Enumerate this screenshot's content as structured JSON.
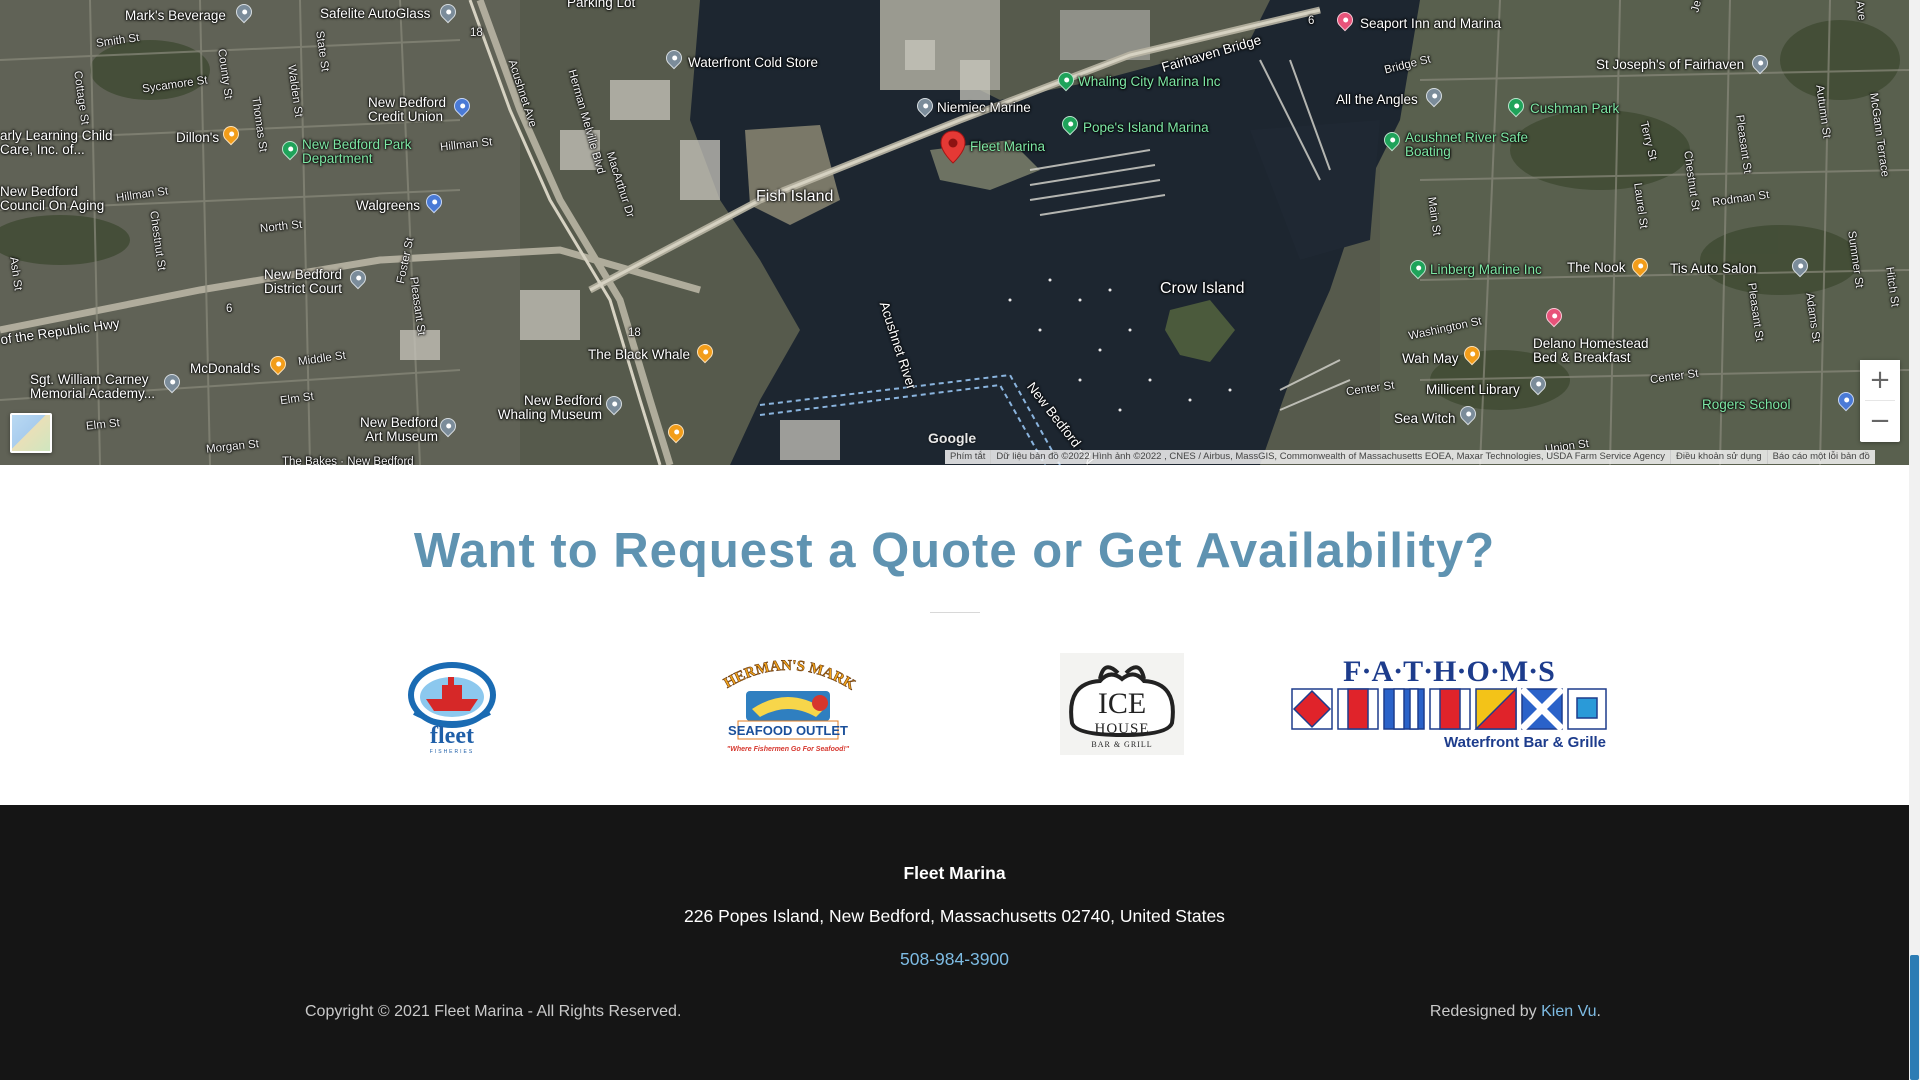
{
  "map": {
    "labels": {
      "marks_beverage": "Mark's Beverage",
      "safelite": "Safelite AutoGlass",
      "parking_lot": "Parking Lot",
      "waterfront_cold_store": "Waterfront Cold Store",
      "seaport_inn": "Seaport Inn and Marina",
      "fairhaven_bridge": "Fairhaven Bridge",
      "whaling_city_marina": "Whaling City Marina Inc",
      "niemiec_marine": "Niemiec Marine",
      "popes_island_marina": "Pope's Island Marina",
      "fleet_marina": "Fleet Marina",
      "fish_island": "Fish Island",
      "all_the_angles": "All the Angles",
      "acushnet_safe_boating": "Acushnet River Safe Boating",
      "st_josephs": "St Joseph's of Fairhaven",
      "cushman_park": "Cushman Park",
      "nb_credit_union": "New Bedford Credit Union",
      "dillons": "Dillon's",
      "nb_park_dept": "New Bedford Park Department",
      "early_learning": "arly Learning Child Care, Inc. of...",
      "nb_council_aging": "New Bedford Council On Aging",
      "walgreens": "Walgreens",
      "nb_district_court": "New Bedford District Court",
      "republic_hwy": "of the Republic Hwy",
      "mcdonalds": "McDonald's",
      "carney_academy": "Sgt. William Carney Memorial Academy...",
      "black_whale": "The Black Whale",
      "nb_whaling_museum": "New Bedford Whaling Museum",
      "nb_art_museum": "New Bedford Art Museum",
      "acushnet_river": "Acushnet River",
      "crow_island": "Crow Island",
      "linberg_marine": "Linberg Marine Inc",
      "the_nook": "The Nook",
      "tis_auto_salon": "Tis Auto Salon",
      "delano_homestead": "Delano Homestead Bed & Breakfast",
      "wah_may": "Wah May",
      "millicent_library": "Millicent Library",
      "sea_witch": "Sea Witch",
      "rogers_school": "Rogers School",
      "new_bedford_route": "New Bedford - N",
      "the_bakes": "The Bakes · New Bedford"
    },
    "streets": {
      "smith_st": "Smith St",
      "sycamore_st": "Sycamore St",
      "cottage_st": "Cottage St",
      "county_st": "County St",
      "thomas_st": "Thomas St",
      "walden_st": "Walden St",
      "state_st": "State St",
      "hillman_st": "Hillman St",
      "hillman_st2": "Hillman St",
      "north_st": "North St",
      "chestnut_st": "Chestnut St",
      "ash_st": "Ash St",
      "foster_st": "Foster St",
      "pleasant_st": "Pleasant St",
      "middle_st": "Middle St",
      "elm_st": "Elm St",
      "elm_st2": "Elm St",
      "morgan_st": "Morgan St",
      "acushnet_ave": "Acushnet Ave",
      "herman_melville": "Herman Melville Blvd",
      "macarthur_dr": "MacArthur Dr",
      "bridge_st": "Bridge St",
      "main_st": "Main St",
      "terry_st": "Terry St",
      "laurel_st": "Laurel St",
      "chestnut_st2": "Chestnut St",
      "rodman_st": "Rodman St",
      "pleasant_st2": "Pleasant St",
      "adams_st": "Adams St",
      "summer_st": "Summer St",
      "hitch_st": "Hitch St",
      "autumn_st": "Autumn St",
      "jefferson_st": "Jefferson St",
      "mcgann_terrace": "McGann Terrace",
      "washington_st": "Washington St",
      "center_st": "Center St",
      "center_st2": "Center St",
      "union_st": "Union St",
      "ave": "Ave",
      "route_6": "6",
      "route_18": "18",
      "route_18b": "18",
      "route_6b": "6"
    },
    "google_logo": "Google",
    "attribution": {
      "shortcuts": "Phím tắt",
      "data": "Dữ liệu bản đồ ©2022 Hình ảnh ©2022 , CNES / Airbus, MassGIS, Commonwealth of Massachusetts EOEA, Maxar Technologies, USDA Farm Service Agency",
      "terms": "Điều khoản sử dụng",
      "report": "Báo cáo một lỗi bản đồ"
    },
    "zoom_in": "+",
    "zoom_out": "−"
  },
  "quote": {
    "title": "Want to Request a Quote or Get Availability?",
    "logos": {
      "fleet": {
        "word": "fleet",
        "sub": "FISHERIES"
      },
      "fishermans": {
        "top": "FISHERMAN'S MARKET",
        "mid": "SEAFOOD OUTLET",
        "tag": "\"Where Fishermen Go For Seafood!\""
      },
      "icehouse": {
        "top": "ICE",
        "mid": "HOUSE",
        "sub": "BAR & GRILL"
      },
      "fathoms": {
        "top": "F·A·T·H·O·M·S",
        "sub": "Waterfront Bar & Grille"
      }
    }
  },
  "footer": {
    "name": "Fleet Marina",
    "address": "226 Popes Island, New Bedford, Massachusetts 02740, United States",
    "phone": "508-984-3900",
    "copyright": "Copyright © 2021 Fleet Marina - All Rights Reserved.",
    "credit_prefix": "Redesigned by ",
    "credit_name": "Kien Vu",
    "credit_suffix": "."
  },
  "colors": {
    "title": "#5f93b1",
    "footer_bg": "#151515",
    "link": "#7dbbe3",
    "scroll_thumb": "#2c7cb4"
  }
}
